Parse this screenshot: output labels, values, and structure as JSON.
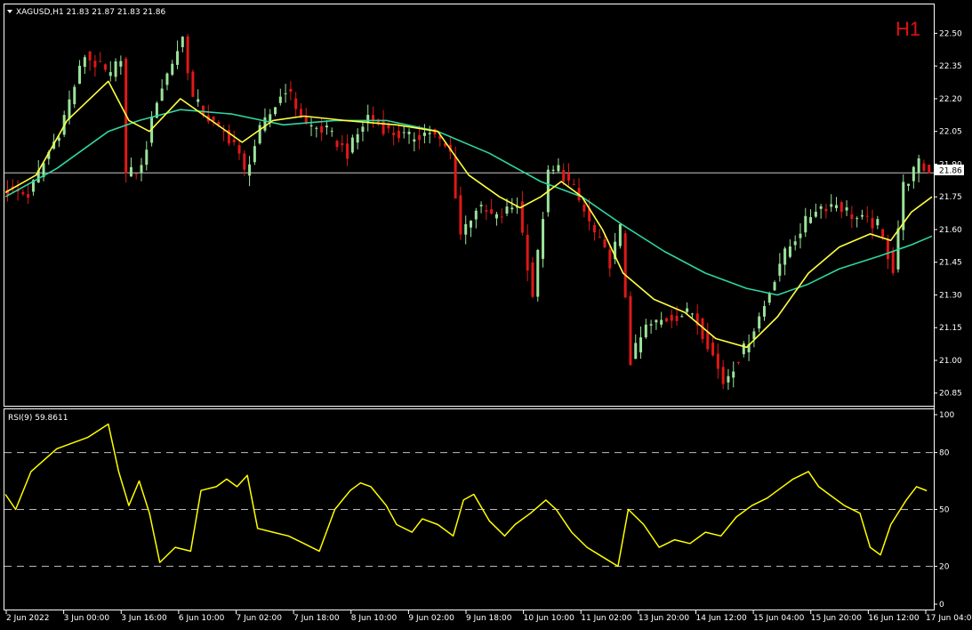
{
  "window": {
    "symbol_header": "XAGUSD,H1  21.83 21.87 21.83 21.86",
    "timeframe_label": "H1",
    "rsi_header": "RSI(9) 59.8611",
    "current_price_label": "21.86"
  },
  "colors": {
    "background": "#000000",
    "bull_candle": "#9be39b",
    "bear_candle": "#e01818",
    "ma_fast": "#ffff40",
    "ma_slow": "#2fd6a0",
    "rsi_line": "#ffff00",
    "grid_text": "#ffffff",
    "timeframe_text": "#e01010"
  },
  "chart_data": [
    {
      "type": "candlestick",
      "symbol": "XAGUSD",
      "timeframe": "H1",
      "y_ticks": [
        "22.50",
        "22.35",
        "22.20",
        "22.05",
        "21.90",
        "21.75",
        "21.60",
        "21.45",
        "21.30",
        "21.15",
        "21.00",
        "20.85"
      ],
      "ylim": [
        20.8,
        22.62
      ],
      "current_price": 21.86,
      "x_ticks": [
        "2 Jun 2022",
        "3 Jun 00:00",
        "3 Jun 16:00",
        "6 Jun 10:00",
        "7 Jun 02:00",
        "7 Jun 18:00",
        "8 Jun 10:00",
        "9 Jun 02:00",
        "9 Jun 18:00",
        "10 Jun 10:00",
        "11 Jun 02:00",
        "13 Jun 20:00",
        "14 Jun 12:00",
        "15 Jun 04:00",
        "15 Jun 20:00",
        "16 Jun 12:00",
        "17 Jun 04:00"
      ],
      "close_path": [
        [
          0,
          21.78
        ],
        [
          4,
          21.76
        ],
        [
          10,
          22.05
        ],
        [
          15,
          22.4
        ],
        [
          20,
          22.3
        ],
        [
          22,
          22.4
        ],
        [
          23,
          21.85
        ],
        [
          26,
          21.88
        ],
        [
          29,
          22.2
        ],
        [
          34,
          22.48
        ],
        [
          36,
          22.2
        ],
        [
          40,
          22.08
        ],
        [
          44,
          22.0
        ],
        [
          46,
          21.86
        ],
        [
          49,
          22.05
        ],
        [
          54,
          22.25
        ],
        [
          58,
          22.08
        ],
        [
          62,
          22.05
        ],
        [
          66,
          21.95
        ],
        [
          70,
          22.12
        ],
        [
          74,
          22.05
        ],
        [
          78,
          22.02
        ],
        [
          82,
          22.05
        ],
        [
          86,
          21.95
        ],
        [
          88,
          21.58
        ],
        [
          91,
          21.7
        ],
        [
          95,
          21.65
        ],
        [
          99,
          21.72
        ],
        [
          102,
          21.3
        ],
        [
          105,
          21.85
        ],
        [
          107,
          21.88
        ],
        [
          110,
          21.78
        ],
        [
          114,
          21.58
        ],
        [
          117,
          21.45
        ],
        [
          119,
          21.6
        ],
        [
          121,
          21.0
        ],
        [
          124,
          21.15
        ],
        [
          129,
          21.2
        ],
        [
          133,
          21.22
        ],
        [
          136,
          21.08
        ],
        [
          139,
          20.9
        ],
        [
          143,
          21.05
        ],
        [
          147,
          21.25
        ],
        [
          150,
          21.45
        ],
        [
          154,
          21.6
        ],
        [
          157,
          21.7
        ],
        [
          161,
          21.72
        ],
        [
          165,
          21.65
        ],
        [
          169,
          21.62
        ],
        [
          172,
          21.42
        ],
        [
          174,
          21.8
        ],
        [
          177,
          21.9
        ],
        [
          179,
          21.86
        ]
      ],
      "ma_fast": [
        [
          0,
          21.77
        ],
        [
          6,
          21.85
        ],
        [
          12,
          22.1
        ],
        [
          20,
          22.28
        ],
        [
          24,
          22.1
        ],
        [
          28,
          22.05
        ],
        [
          34,
          22.2
        ],
        [
          40,
          22.1
        ],
        [
          46,
          22.0
        ],
        [
          52,
          22.1
        ],
        [
          58,
          22.12
        ],
        [
          66,
          22.1
        ],
        [
          76,
          22.08
        ],
        [
          84,
          22.05
        ],
        [
          90,
          21.85
        ],
        [
          96,
          21.75
        ],
        [
          100,
          21.7
        ],
        [
          104,
          21.75
        ],
        [
          108,
          21.82
        ],
        [
          112,
          21.75
        ],
        [
          116,
          21.6
        ],
        [
          120,
          21.4
        ],
        [
          126,
          21.28
        ],
        [
          132,
          21.22
        ],
        [
          138,
          21.1
        ],
        [
          144,
          21.06
        ],
        [
          150,
          21.2
        ],
        [
          156,
          21.4
        ],
        [
          162,
          21.52
        ],
        [
          168,
          21.58
        ],
        [
          172,
          21.55
        ],
        [
          176,
          21.68
        ],
        [
          180,
          21.75
        ]
      ],
      "ma_slow": [
        [
          0,
          21.75
        ],
        [
          10,
          21.88
        ],
        [
          20,
          22.05
        ],
        [
          26,
          22.1
        ],
        [
          34,
          22.15
        ],
        [
          44,
          22.13
        ],
        [
          54,
          22.08
        ],
        [
          64,
          22.1
        ],
        [
          74,
          22.1
        ],
        [
          84,
          22.05
        ],
        [
          94,
          21.95
        ],
        [
          104,
          21.82
        ],
        [
          112,
          21.75
        ],
        [
          120,
          21.62
        ],
        [
          128,
          21.5
        ],
        [
          136,
          21.4
        ],
        [
          144,
          21.33
        ],
        [
          150,
          21.3
        ],
        [
          156,
          21.35
        ],
        [
          162,
          21.42
        ],
        [
          170,
          21.48
        ],
        [
          176,
          21.53
        ],
        [
          180,
          21.57
        ]
      ]
    },
    {
      "type": "line",
      "series": [
        {
          "name": "RSI(9)",
          "last_value": 59.8611
        }
      ],
      "y_ticks": [
        "100",
        "80",
        "50",
        "20",
        "0"
      ],
      "ylim": [
        0,
        100
      ],
      "levels": [
        80,
        50,
        20
      ],
      "points": [
        [
          0,
          58
        ],
        [
          2,
          50
        ],
        [
          5,
          70
        ],
        [
          10,
          82
        ],
        [
          16,
          88
        ],
        [
          20,
          95
        ],
        [
          22,
          70
        ],
        [
          24,
          52
        ],
        [
          26,
          65
        ],
        [
          28,
          48
        ],
        [
          30,
          22
        ],
        [
          33,
          30
        ],
        [
          36,
          28
        ],
        [
          38,
          60
        ],
        [
          41,
          62
        ],
        [
          43,
          66
        ],
        [
          45,
          62
        ],
        [
          47,
          68
        ],
        [
          49,
          40
        ],
        [
          52,
          38
        ],
        [
          55,
          36
        ],
        [
          58,
          32
        ],
        [
          61,
          28
        ],
        [
          64,
          50
        ],
        [
          67,
          60
        ],
        [
          69,
          64
        ],
        [
          71,
          62
        ],
        [
          74,
          52
        ],
        [
          76,
          42
        ],
        [
          79,
          38
        ],
        [
          81,
          45
        ],
        [
          84,
          42
        ],
        [
          87,
          36
        ],
        [
          89,
          55
        ],
        [
          91,
          58
        ],
        [
          94,
          44
        ],
        [
          97,
          36
        ],
        [
          99,
          42
        ],
        [
          102,
          48
        ],
        [
          105,
          55
        ],
        [
          107,
          50
        ],
        [
          110,
          38
        ],
        [
          113,
          30
        ],
        [
          116,
          25
        ],
        [
          119,
          20
        ],
        [
          121,
          50
        ],
        [
          124,
          42
        ],
        [
          127,
          30
        ],
        [
          130,
          34
        ],
        [
          133,
          32
        ],
        [
          136,
          38
        ],
        [
          139,
          36
        ],
        [
          142,
          46
        ],
        [
          145,
          52
        ],
        [
          148,
          56
        ],
        [
          150,
          60
        ],
        [
          153,
          66
        ],
        [
          156,
          70
        ],
        [
          158,
          62
        ],
        [
          160,
          58
        ],
        [
          163,
          52
        ],
        [
          166,
          48
        ],
        [
          168,
          30
        ],
        [
          170,
          26
        ],
        [
          172,
          42
        ],
        [
          175,
          55
        ],
        [
          177,
          62
        ],
        [
          179,
          59.86
        ]
      ]
    }
  ]
}
